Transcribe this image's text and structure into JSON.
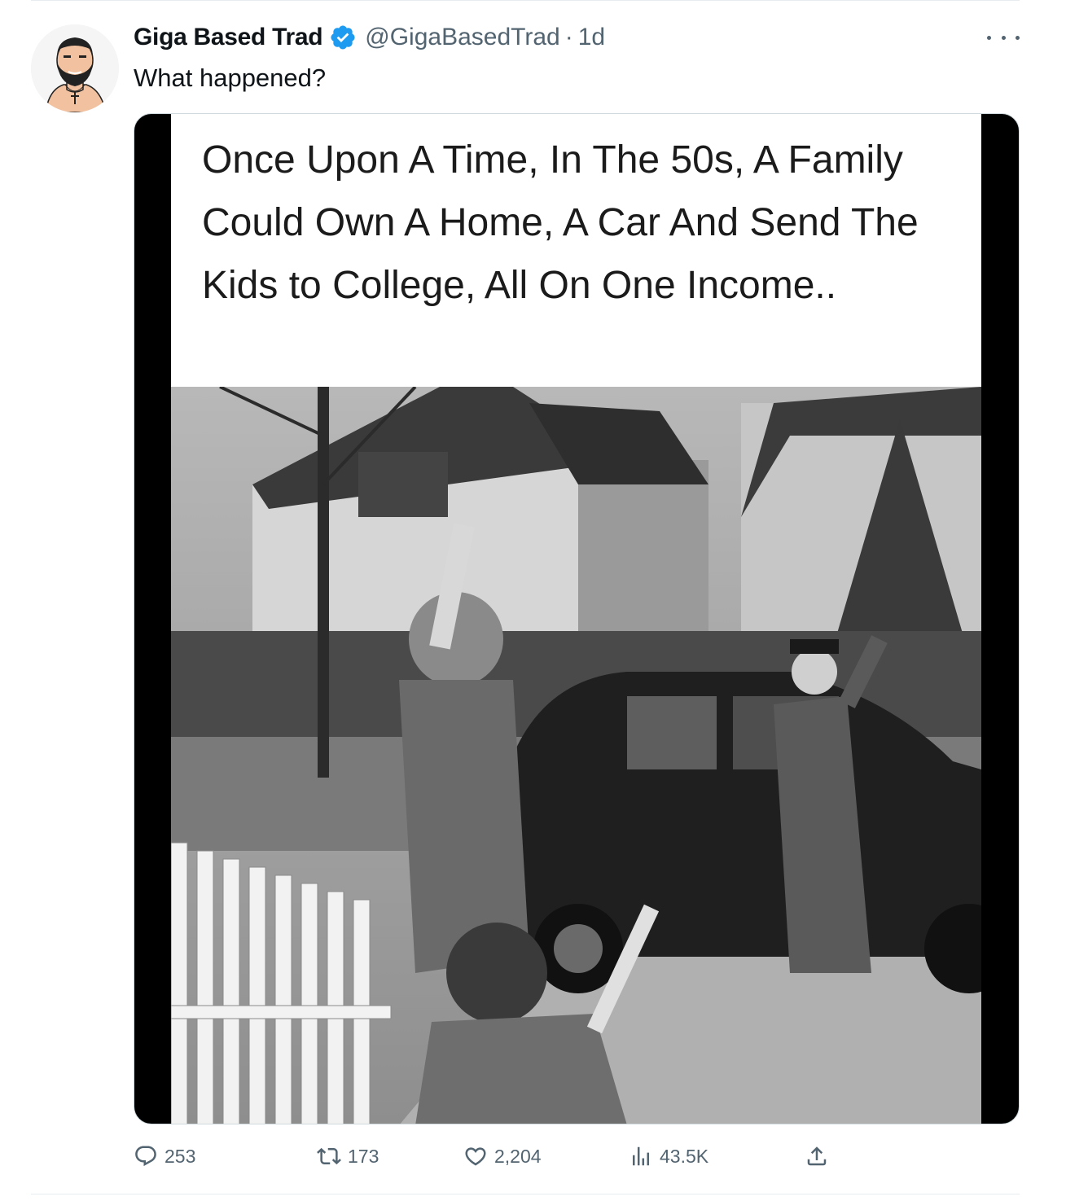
{
  "post": {
    "author": {
      "display_name": "Giga Based Trad",
      "handle": "@GigaBasedTrad",
      "verified": true,
      "avatar_icon": "bearded-man-avatar"
    },
    "separator": "·",
    "time": "1d",
    "text": "What happened?",
    "media": {
      "caption": "Once Upon A Time, In The 50s, A Family Could Own A Home, A Car And Send The Kids to College, All On One Income..",
      "photo_icon": "vintage-family-photo"
    },
    "actions": {
      "replies": "253",
      "reposts": "173",
      "likes": "2,204",
      "views": "43.5K"
    }
  },
  "colors": {
    "text_primary": "#0f1419",
    "text_secondary": "#536471",
    "verified_blue": "#1d9bf0",
    "divider": "#e6ecf0"
  }
}
